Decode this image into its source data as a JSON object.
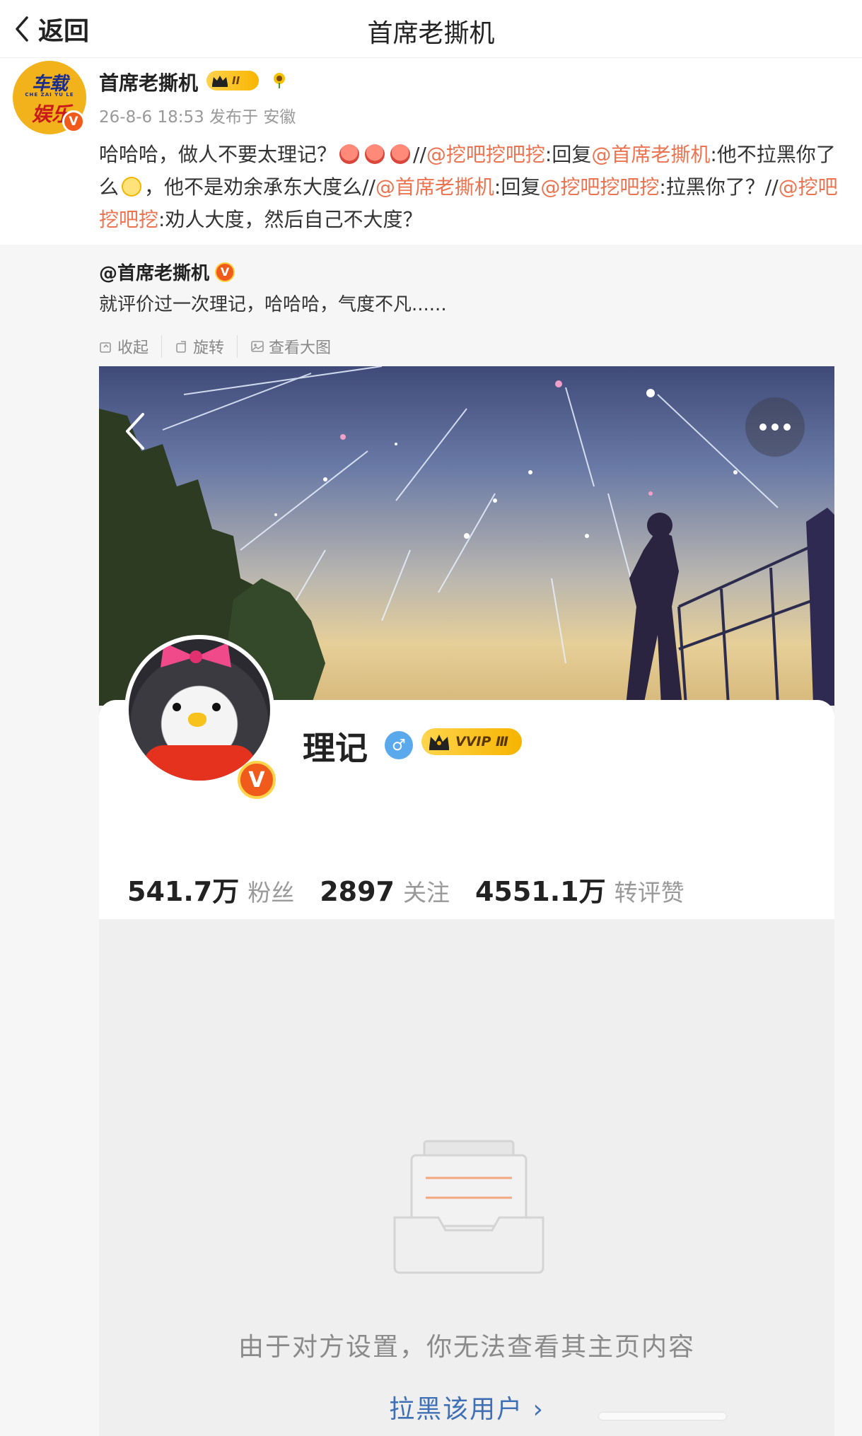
{
  "nav": {
    "back_label": "返回",
    "title": "首席老撕机"
  },
  "post": {
    "author": "首席老撕机",
    "avatar_text_top": "车载",
    "avatar_text_sub": "CHE ZAI YU LE",
    "avatar_text_bottom": "娱乐",
    "level_badge": "II",
    "verified_mark": "V",
    "meta": "26-8-6 18:53  发布于 安徽",
    "body": [
      {
        "t": "text",
        "v": "哈哈哈，做人不要太理记？"
      },
      {
        "t": "emoji",
        "v": "laugh"
      },
      {
        "t": "emoji",
        "v": "laugh"
      },
      {
        "t": "emoji",
        "v": "laugh"
      },
      {
        "t": "text",
        "v": "//"
      },
      {
        "t": "mention",
        "v": "@挖吧挖吧挖"
      },
      {
        "t": "text",
        "v": ":回复"
      },
      {
        "t": "mention",
        "v": "@首席老撕机"
      },
      {
        "t": "text",
        "v": ":他不拉黑你了么"
      },
      {
        "t": "emoji",
        "v": "smile"
      },
      {
        "t": "text",
        "v": "，他不是劝余承东大度么//"
      },
      {
        "t": "mention",
        "v": "@首席老撕机"
      },
      {
        "t": "text",
        "v": ":回复"
      },
      {
        "t": "mention",
        "v": "@挖吧挖吧挖"
      },
      {
        "t": "text",
        "v": ":拉黑你了？//"
      },
      {
        "t": "mention",
        "v": "@挖吧挖吧挖"
      },
      {
        "t": "text",
        "v": ":劝人大度，然后自己不大度？"
      }
    ]
  },
  "repost": {
    "author": "@首席老撕机",
    "verified_mark": "V",
    "text": "就评价过一次理记，哈哈哈，气度不凡......",
    "tools": [
      "收起",
      "旋转",
      "查看大图"
    ]
  },
  "screenshot": {
    "profile_name": "理记",
    "gender_symbol": "♂",
    "vvip_label": "VVIP Ⅲ",
    "verified_mark": "V",
    "stats": [
      {
        "num": "541.7万",
        "label": "粉丝"
      },
      {
        "num": "2897",
        "label": "关注"
      },
      {
        "num": "4551.1万",
        "label": "转评赞"
      }
    ],
    "empty_message": "由于对方设置，你无法查看其主页内容",
    "block_link": "拉黑该用户 ›"
  },
  "colors": {
    "mention": "#eb7350",
    "link_blue": "#3f6fb5",
    "verified_orange": "#f05a1a",
    "gold": "#f7b500"
  }
}
